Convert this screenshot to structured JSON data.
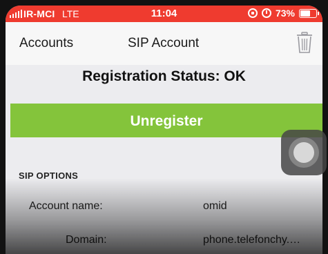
{
  "status_bar": {
    "carrier": "IR-MCI",
    "network": "LTE",
    "time": "11:04",
    "battery": "73%",
    "battery_level": 0.73,
    "background_color": "#ef3b2f"
  },
  "nav": {
    "back_label": "Accounts",
    "title": "SIP Account",
    "trash_icon": "trash-icon"
  },
  "registration": {
    "status_text": "Registration Status: OK"
  },
  "unregister_button": {
    "label": "Unregister",
    "color": "#84c43b"
  },
  "sip_options": {
    "header": "SIP OPTIONS",
    "rows": [
      {
        "label": "Account name:",
        "value": "omid"
      },
      {
        "label": "Domain:",
        "value": "phone.telefonchy.…"
      }
    ]
  }
}
